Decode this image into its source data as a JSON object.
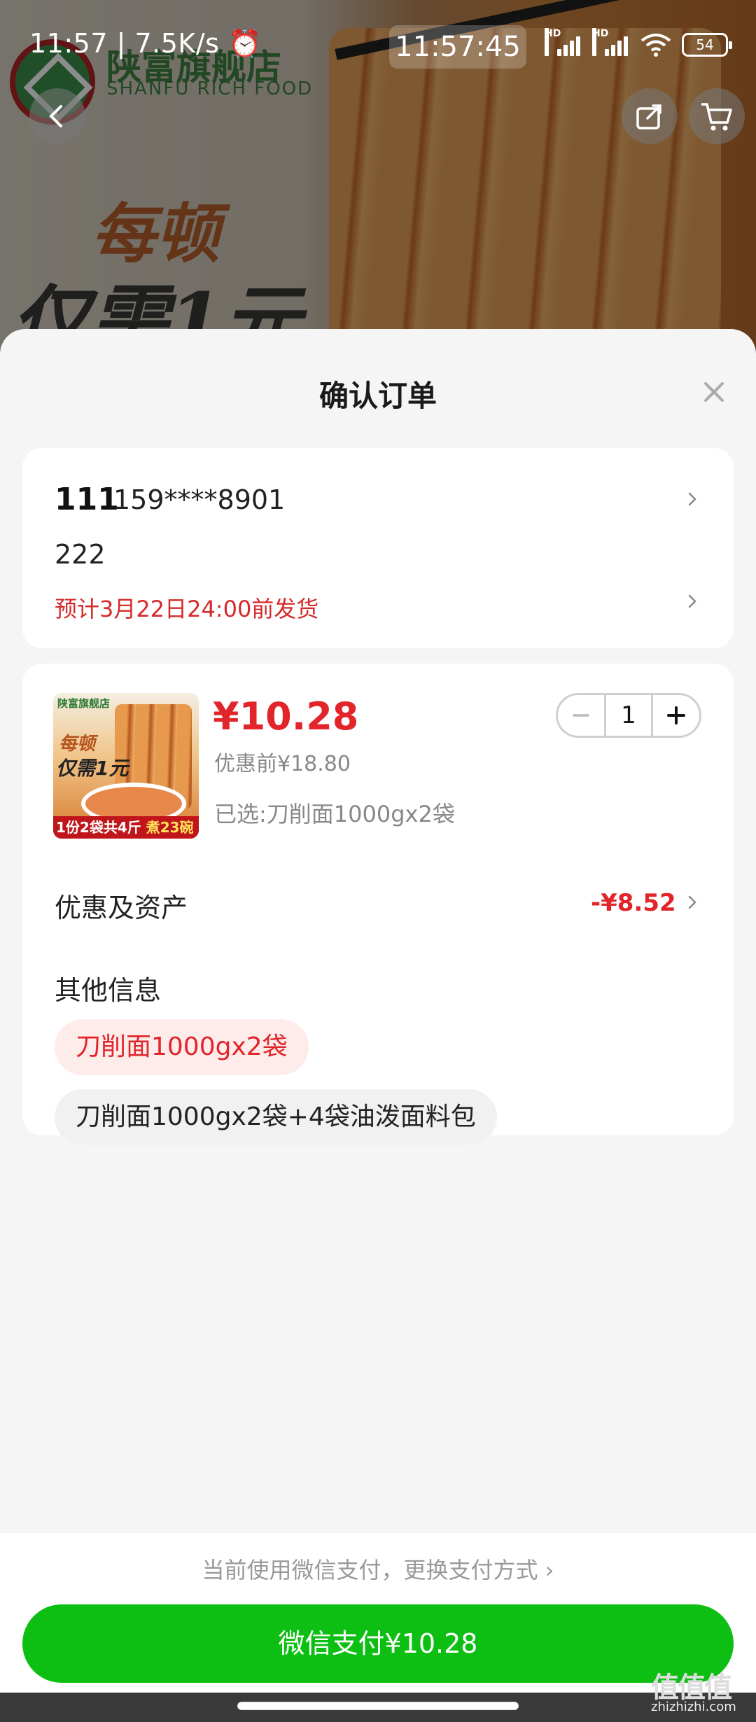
{
  "status_bar": {
    "left": "11:57 | 7.5K/s ⏰",
    "clock": "11:57:45",
    "battery": "54",
    "hd": "HD"
  },
  "background": {
    "brand_name": "陕富旗舰店",
    "brand_sub": "SHANFU RICH FOOD",
    "promo_line1": "每顿",
    "promo_line2": "仅需1元"
  },
  "sheet": {
    "title": "确认订单",
    "address": {
      "name": "111",
      "phone": "159****8901",
      "line": "222",
      "ship_estimate": "预计3月22日24:00前发货"
    },
    "item": {
      "thumb_logo": "陕富旗舰店",
      "thumb_text1": "每顿",
      "thumb_text2": "仅需1元",
      "thumb_band_a": "1份2袋共4斤",
      "thumb_band_b": "煮23碗",
      "price": "¥10.28",
      "original_price": "优惠前¥18.80",
      "spec": "已选:刀削面1000gx2袋",
      "quantity": "1"
    },
    "discount": {
      "label": "优惠及资产",
      "value": "-¥8.52"
    },
    "other": {
      "label": "其他信息",
      "options": [
        "刀削面1000gx2袋",
        "刀削面1000gx2袋+4袋油泼面料包"
      ]
    },
    "payment": {
      "hint": "当前使用微信支付，更换支付方式 ›",
      "button": "微信支付¥10.28"
    }
  },
  "watermark": {
    "main": "值值值",
    "sub": "zhizhizhi.com"
  },
  "colors": {
    "accent_red": "#e1252b",
    "pay_green": "#0dbf13"
  }
}
